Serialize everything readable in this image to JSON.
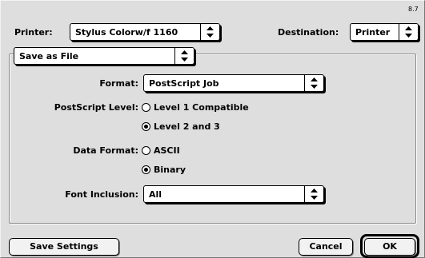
{
  "dialog": {
    "version": "8.7",
    "printer_label": "Printer:",
    "printer_value": "Stylus Colorw/f 1160",
    "destination_label": "Destination:",
    "destination_value": "Printer",
    "panel_value": "Save as File"
  },
  "options": {
    "format_label": "Format:",
    "format_value": "PostScript Job",
    "ps_level_label": "PostScript Level:",
    "ps_level_options": [
      "Level 1 Compatible",
      "Level 2 and 3"
    ],
    "ps_level_selected": "Level 2 and 3",
    "data_format_label": "Data Format:",
    "data_format_options": [
      "ASCII",
      "Binary"
    ],
    "data_format_selected": "Binary",
    "font_inclusion_label": "Font Inclusion:",
    "font_inclusion_value": "All"
  },
  "buttons": {
    "save_settings": "Save Settings",
    "cancel": "Cancel",
    "ok": "OK"
  },
  "icons": {
    "popup_arrow": "up-down-arrows-icon"
  }
}
